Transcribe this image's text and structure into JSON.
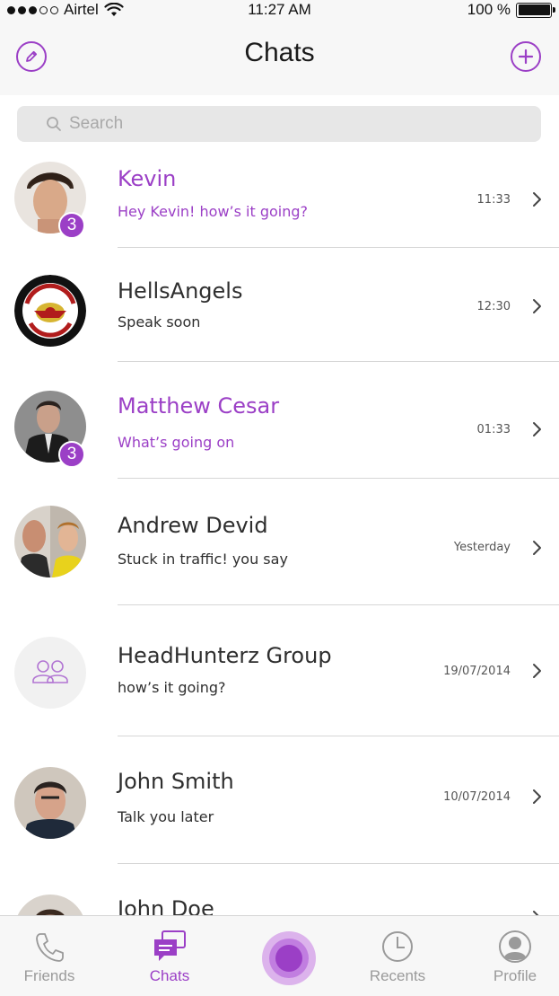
{
  "status_bar": {
    "carrier": "Airtel",
    "time": "11:27 AM",
    "battery": "100 %",
    "battery_level": 1.0,
    "signal_bars": 3,
    "signal_total": 5
  },
  "header": {
    "title": "Chats",
    "left_icon": "compose-icon",
    "right_icon": "add-icon"
  },
  "search": {
    "placeholder": "Search",
    "icon": "search-icon"
  },
  "chats": [
    {
      "name": "Kevin",
      "message": "Hey Kevin! how’s it going?",
      "time": "11:33",
      "badge": "3",
      "unread": true,
      "avatar": "photo"
    },
    {
      "name": "HellsAngels",
      "message": "Speak soon",
      "time": "12:30",
      "badge": "",
      "unread": false,
      "avatar": "logo"
    },
    {
      "name": "Matthew Cesar",
      "message": "What’s going on",
      "time": "01:33",
      "badge": "3",
      "unread": true,
      "avatar": "photo"
    },
    {
      "name": "Andrew Devid",
      "message": "Stuck in traffic! you say",
      "time": "Yesterday",
      "badge": "",
      "unread": false,
      "avatar": "photo"
    },
    {
      "name": "HeadHunterz Group",
      "message": "how’s it going?",
      "time": "19/07/2014",
      "badge": "",
      "unread": false,
      "avatar": "group-icon"
    },
    {
      "name": "John Smith",
      "message": "Talk you later",
      "time": "10/07/2014",
      "badge": "",
      "unread": false,
      "avatar": "photo"
    },
    {
      "name": "John Doe",
      "message": "",
      "time": "",
      "badge": "",
      "unread": false,
      "avatar": "photo"
    }
  ],
  "tabs": [
    {
      "label": "Friends",
      "icon": "phone-icon",
      "active": false
    },
    {
      "label": "Chats",
      "icon": "chat-bubbles-icon",
      "active": true
    },
    {
      "label": "Recents",
      "icon": "clock-icon",
      "active": false
    },
    {
      "label": "Profile",
      "icon": "profile-icon",
      "active": false
    }
  ],
  "colors": {
    "accent": "#9b3fc6",
    "background": "#ffffff",
    "bar_background": "#f7f7f7",
    "divider": "#d6d6d6"
  }
}
